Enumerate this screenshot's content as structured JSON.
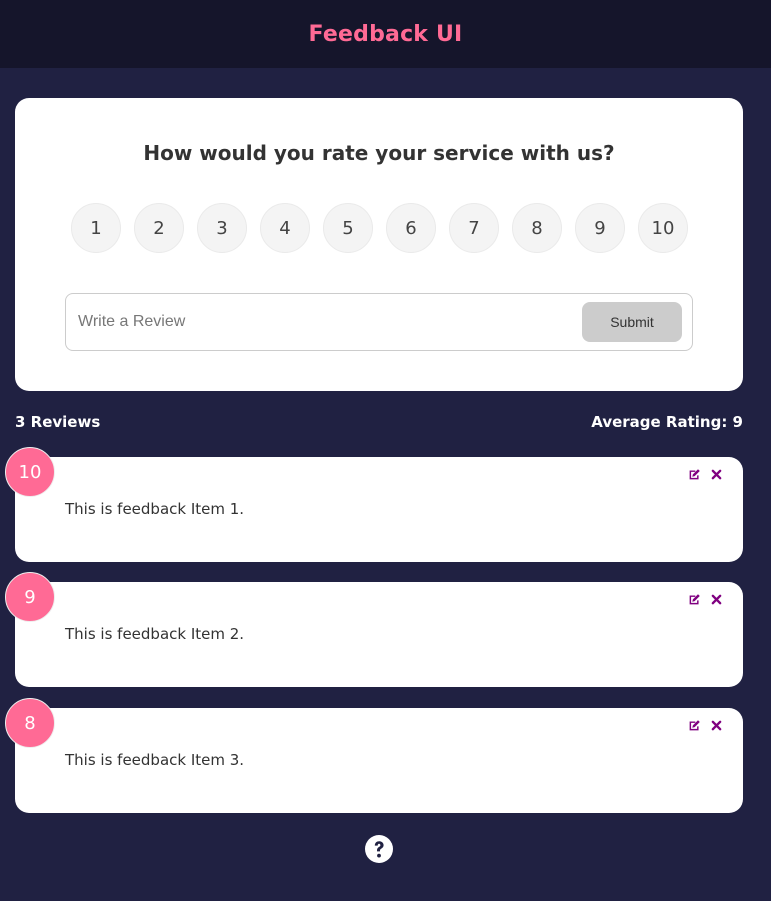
{
  "header": {
    "title": "Feedback UI"
  },
  "rating_card": {
    "question": "How would you rate your service with us?",
    "options": [
      "1",
      "2",
      "3",
      "4",
      "5",
      "6",
      "7",
      "8",
      "9",
      "10"
    ],
    "review_placeholder": "Write a Review",
    "submit_label": "Submit"
  },
  "stats": {
    "count_label": "3 Reviews",
    "average_label": "Average Rating: 9"
  },
  "feedback": [
    {
      "rating": "10",
      "text": "This is feedback Item 1."
    },
    {
      "rating": "9",
      "text": "This is feedback Item 2."
    },
    {
      "rating": "8",
      "text": "This is feedback Item 3."
    }
  ],
  "icons": {
    "edit": "edit-icon",
    "delete": "close-icon",
    "help": "question-circle-icon"
  },
  "colors": {
    "background": "#202142",
    "header_bg": "#15152b",
    "accent_pink": "#ff6a95",
    "icon_purple": "#800080"
  }
}
